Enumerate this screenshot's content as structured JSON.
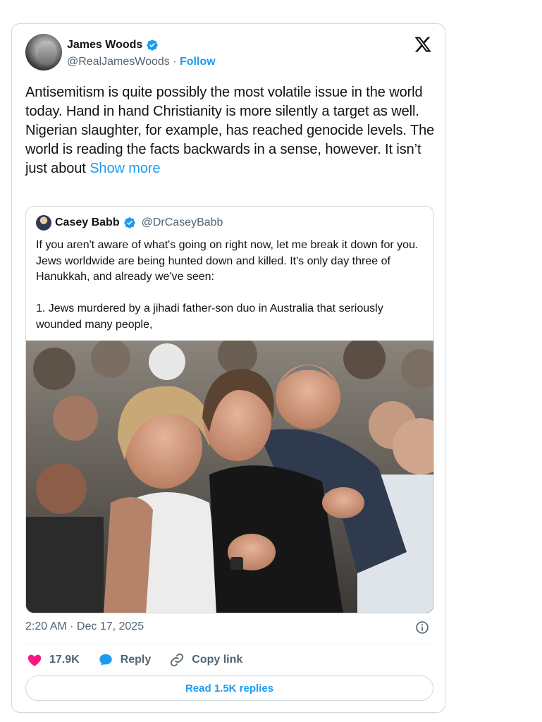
{
  "author": {
    "name": "James Woods",
    "handle": "@RealJamesWoods",
    "separator": " · ",
    "follow_label": "Follow"
  },
  "tweet": {
    "text": "Antisemitism is quite possibly the most volatile issue in the world today. Hand in hand Christianity is more silently a target as well. Nigerian slaughter, for example, has reached genocide levels. The world is reading the facts backwards in a sense, however. It isn’t just about ",
    "show_more": "Show more"
  },
  "quote": {
    "name": "Casey Babb",
    "handle": "@DrCaseyBabb",
    "lines": [
      "If you aren't aware of what's going on right now, let me break it down for you. Jews worldwide are being hunted down and killed. It's only day three of Hanukkah, and already we've seen:",
      "",
      "1. Jews murdered by a jihadi father-son duo in Australia that seriously wounded many people,"
    ]
  },
  "timestamp": "2:20 AM · Dec 17, 2025",
  "actions": {
    "likes": "17.9K",
    "reply_label": "Reply",
    "copy_link_label": "Copy link"
  },
  "read_replies_label": "Read 1.5K replies",
  "colors": {
    "accent": "#1d9bf0",
    "like": "#f91880",
    "muted": "#536471",
    "border": "#cfd9de"
  },
  "icons": [
    "verified-badge-icon",
    "x-logo-icon",
    "info-icon",
    "heart-icon",
    "reply-bubble-icon",
    "link-icon"
  ]
}
